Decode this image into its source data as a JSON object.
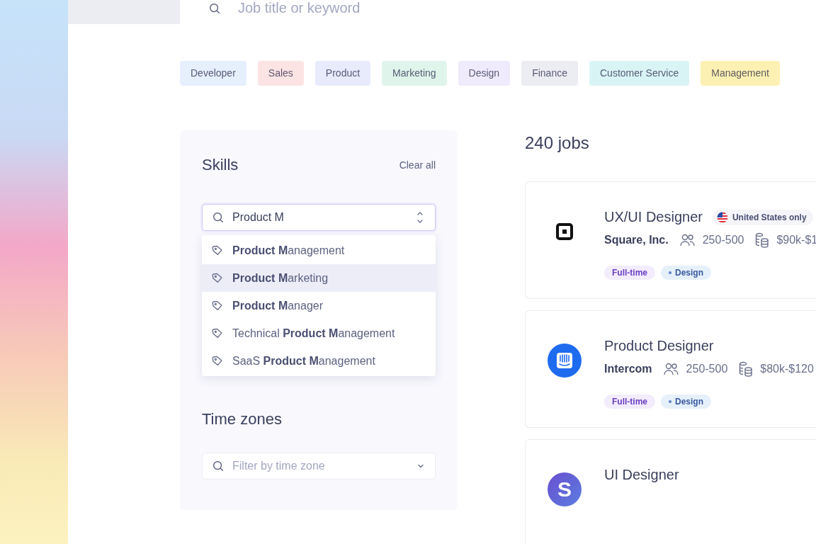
{
  "search": {
    "placeholder": "Job title or keyword"
  },
  "categories": [
    {
      "label": "Developer",
      "color": "#e6effc"
    },
    {
      "label": "Sales",
      "color": "#fde4e4"
    },
    {
      "label": "Product",
      "color": "#e8ebfc"
    },
    {
      "label": "Marketing",
      "color": "#dff5eb"
    },
    {
      "label": "Design",
      "color": "#efebfc"
    },
    {
      "label": "Finance",
      "color": "#ecedf2"
    },
    {
      "label": "Customer Service",
      "color": "#d9f4f5"
    },
    {
      "label": "Management",
      "color": "#fcf1b2"
    }
  ],
  "skills": {
    "title": "Skills",
    "clear": "Clear all",
    "value": "Product M",
    "suggestions": [
      {
        "label": "**Product M**anagement",
        "selected": false
      },
      {
        "label": "**Product M**arketing",
        "selected": true
      },
      {
        "label": "**Product M**anager",
        "selected": false
      },
      {
        "label": "Technical **Product M**anagement",
        "selected": false
      },
      {
        "label": "SaaS **Product M**anagement",
        "selected": false
      }
    ]
  },
  "time_zones": {
    "title": "Time zones",
    "placeholder": "Filter by time zone"
  },
  "jobs": {
    "count": "240 jobs",
    "items": [
      {
        "logo": {
          "kind": "square"
        },
        "title": "UX/UI Designer",
        "location": "United States only",
        "company": "Square, Inc.",
        "size": "250-500",
        "salary": "$90k-$1",
        "tags": [
          {
            "kind": "type",
            "label": "Full-time"
          },
          {
            "kind": "category",
            "label": "Design"
          }
        ]
      },
      {
        "logo": {
          "kind": "intercom"
        },
        "title": "Product Designer",
        "company": "Intercom",
        "size": "250-500",
        "salary": "$80k-$120",
        "tags": [
          {
            "kind": "type",
            "label": "Full-time"
          },
          {
            "kind": "category",
            "label": "Design"
          }
        ]
      },
      {
        "logo": {
          "kind": "letter",
          "text": "S"
        },
        "title": "UI Designer"
      }
    ]
  }
}
